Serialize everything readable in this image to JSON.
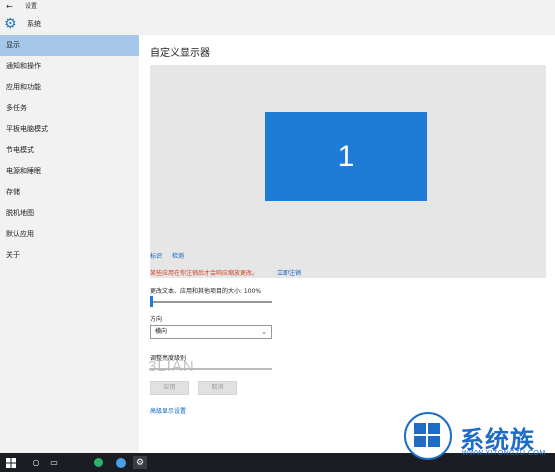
{
  "window": {
    "title": "设置"
  },
  "header": {
    "section_title": "系统",
    "icon": "gear-icon"
  },
  "sidebar": {
    "items": [
      {
        "label": "显示",
        "active": true
      },
      {
        "label": "通知和操作"
      },
      {
        "label": "应用和功能"
      },
      {
        "label": "多任务"
      },
      {
        "label": "平板电脑模式"
      },
      {
        "label": "节电模式"
      },
      {
        "label": "电源和睡眠"
      },
      {
        "label": "存储"
      },
      {
        "label": "脱机地图"
      },
      {
        "label": "默认应用"
      },
      {
        "label": "关于"
      }
    ]
  },
  "main": {
    "title": "自定义显示器",
    "monitor_number": "1",
    "identify_label": "标识",
    "detect_label": "检测",
    "warning_text": "某些应用在你注销后才会响应缩放更改。",
    "signout_link": "立即注销",
    "scale_label": "更改文本、应用和其他项目的大小: 100%",
    "scale_value_percent": 100,
    "orientation_label": "方向",
    "orientation_value": "横向",
    "brightness_label": "调整亮度级别",
    "apply_label": "应用",
    "cancel_label": "取消",
    "advanced_link": "高级显示设置"
  },
  "watermark": {
    "text": "3LIAN"
  },
  "brand": {
    "name": "系统族",
    "url": "WWW.XITONGZU.COM"
  },
  "colors": {
    "accent": "#1e7cd6",
    "sidebar_active": "#a5c8ea",
    "warning": "#d04020",
    "link": "#0b63c4",
    "taskbar": "#1a1d22",
    "brand": "#1e6cc4"
  }
}
